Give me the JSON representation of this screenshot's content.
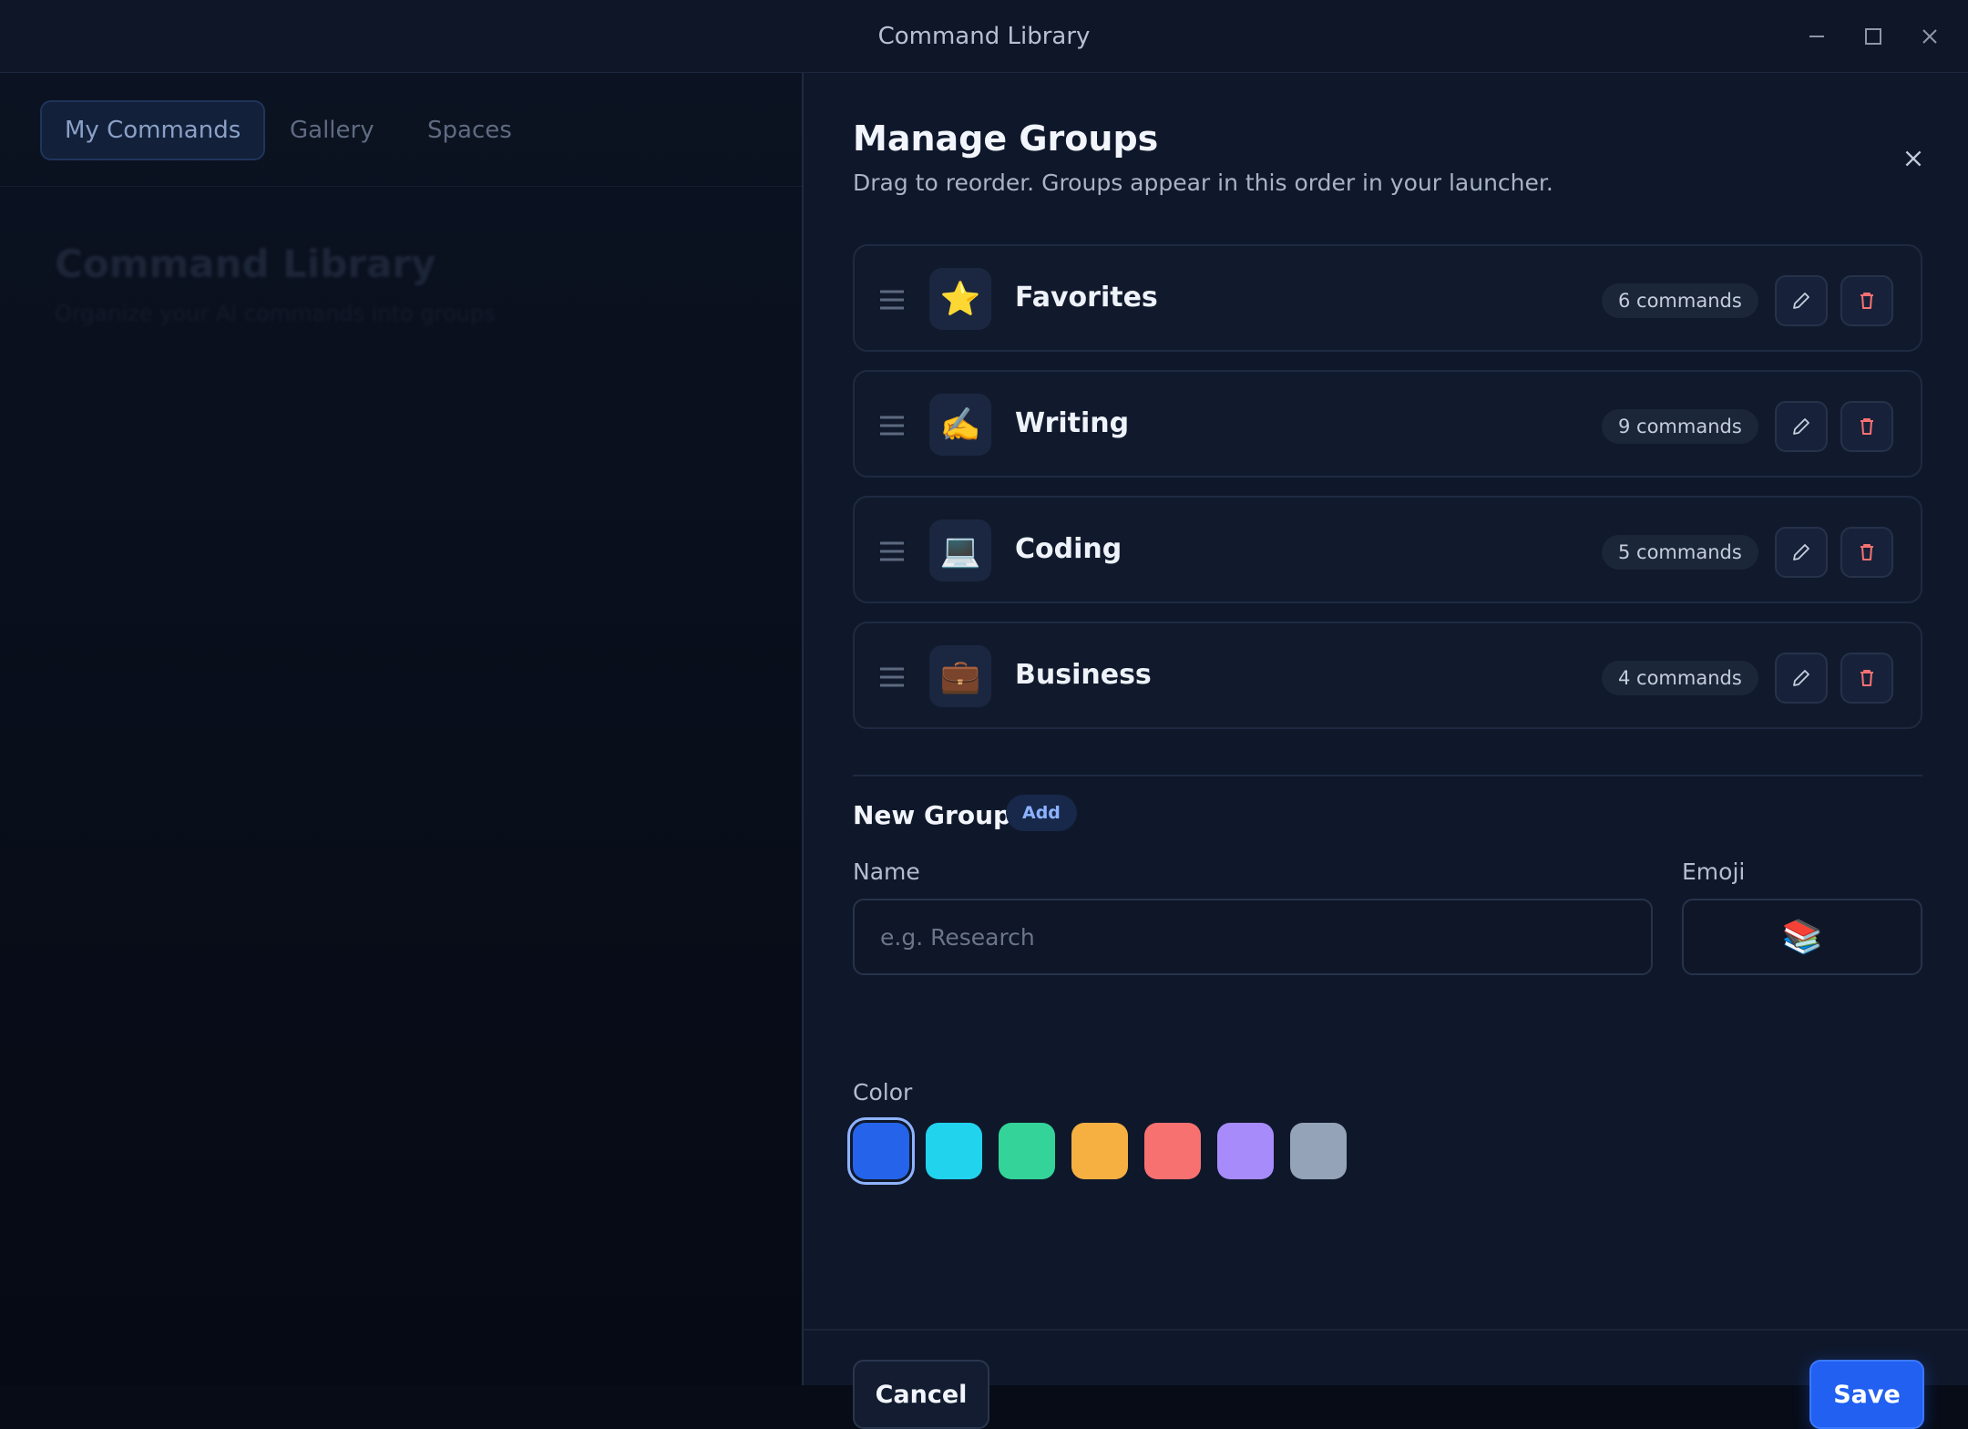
{
  "window": {
    "title": "Command Library",
    "controls": [
      "minimize-icon",
      "maximize-icon",
      "close-icon"
    ]
  },
  "background": {
    "tabs": [
      {
        "label": "My Commands",
        "active": true
      },
      {
        "label": "Gallery",
        "active": false
      },
      {
        "label": "Spaces",
        "active": false
      }
    ],
    "heading": "Command Library",
    "subheading": "Organize your AI commands into groups"
  },
  "dialog": {
    "title": "Manage Groups",
    "subtitle": "Drag to reorder. Groups appear in this order in your launcher.",
    "groups": [
      {
        "emoji": "⭐",
        "name": "Favorites",
        "count": "6 commands"
      },
      {
        "emoji": "✍️",
        "name": "Writing",
        "count": "9 commands"
      },
      {
        "emoji": "💻",
        "name": "Coding",
        "count": "5 commands"
      },
      {
        "emoji": "💼",
        "name": "Business",
        "count": "4 commands"
      }
    ],
    "new_group": {
      "title": "New Group",
      "add_label": "Add",
      "name_label": "Name",
      "name_value": "",
      "name_placeholder": "e.g. Research",
      "emoji_label": "Emoji",
      "emoji_value": "📚",
      "color_label": "Color",
      "colors": [
        "#2563eb",
        "#22d3ee",
        "#34d399",
        "#f5b041",
        "#f87171",
        "#a78bfa",
        "#94a3b8"
      ],
      "selected_color": "#2563eb"
    },
    "cancel_label": "Cancel",
    "save_label": "Save"
  },
  "colors": {
    "accent": "#2160f0",
    "delete": "#f87171",
    "panel_bg": "#0f182b"
  }
}
